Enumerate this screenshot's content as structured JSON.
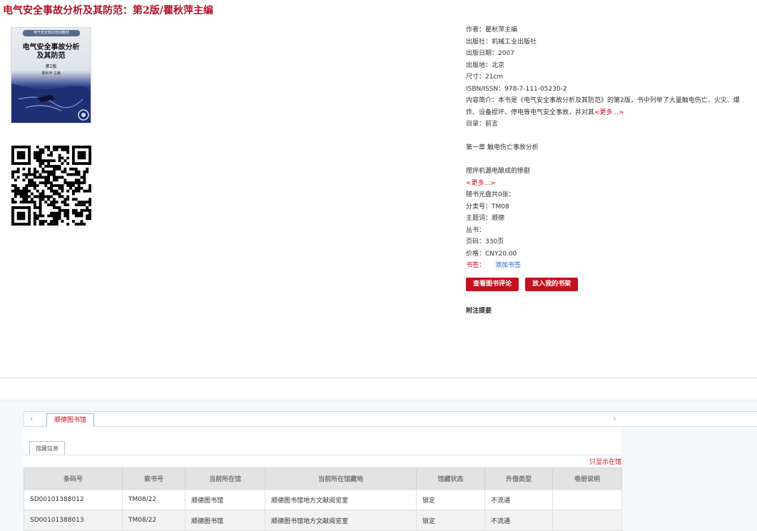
{
  "title": "电气安全事故分析及其防范：第2版/瞿秋萍主编",
  "cover": {
    "series": "电气安全知识培训教材",
    "title_line1": "电气安全事故分析",
    "title_line2": "及其防范",
    "edition": "第2版",
    "author": "瞿秋萍 主编"
  },
  "info": {
    "author": "作者：瞿秋萍主编",
    "publisher": "出版社：机械工业出版社",
    "pub_date": "出版日期：2007",
    "pub_place": "出版地：北京",
    "size": "尺寸：21cm",
    "isbn": "ISBN/ISSN：978-7-111-05230-2",
    "summary": "内容简介：本书是《电气安全事故分析及其防范》的第2版，书中列举了大量触电伤亡、火灾、爆炸、设备损坏、停电等电气安全事故，并对其",
    "more1": "<更多...>",
    "toc": "目录：前言",
    "toc_ch1": "第一章 触电伤亡事故分析",
    "toc_item": "搅拌机漏电酿成的惨剧",
    "more2": "<更多...>",
    "cd": "随书光盘共0张：",
    "class": "分类号：TM08",
    "subject": "主题词：顺德",
    "series": "丛书：",
    "pages": "页码：330页",
    "price": "价格：CNY20.00",
    "bookmark_label": "书签：",
    "bookmark_add": "添加书签"
  },
  "buttons": {
    "reviews": "查看图书评论",
    "shelf": "放入我的书架"
  },
  "note": "附注提要",
  "tabs": {
    "library": "顺德图书馆",
    "holding": "馆藏信息",
    "only_available": "只显示在馆"
  },
  "table": {
    "headers": [
      "条码号",
      "索书号",
      "当前所在馆",
      "当前所在馆藏地",
      "馆藏状态",
      "外借类型",
      "卷册说明"
    ],
    "rows": [
      [
        "SD00101388012",
        "TM08/22",
        "顺德图书馆",
        "顺德图书馆地方文献阅览室",
        "锁定",
        "不流通",
        ""
      ],
      [
        "SD00101388013",
        "TM08/22",
        "顺德图书馆",
        "顺德图书馆地方文献阅览室",
        "锁定",
        "不流通",
        ""
      ]
    ]
  },
  "colors": {
    "accent": "#c4101f",
    "title": "#b3132a",
    "link": "#2d6ab8"
  }
}
